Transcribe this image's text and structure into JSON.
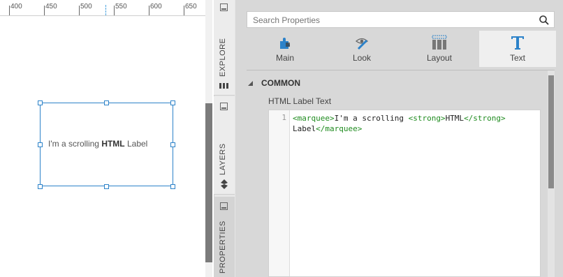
{
  "ruler": {
    "ticks": [
      "400",
      "450",
      "500",
      "550",
      "600",
      "650"
    ]
  },
  "canvas": {
    "label_widget": {
      "prefix": "I'm a scrolling ",
      "bold": "HTML",
      "suffix": " Label"
    }
  },
  "side_tabs": [
    {
      "label": "EXPLORE"
    },
    {
      "label": "LAYERS"
    },
    {
      "label": "PROPERTIES"
    }
  ],
  "properties_panel": {
    "search": {
      "placeholder": "Search Properties"
    },
    "categories": [
      {
        "label": "Main",
        "icon": "puzzle-icon"
      },
      {
        "label": "Look",
        "icon": "paint-brush-icon"
      },
      {
        "label": "Layout",
        "icon": "layout-grid-icon"
      },
      {
        "label": "Text",
        "icon": "text-t-icon",
        "selected": true
      }
    ],
    "section_title": "COMMON",
    "property_label": "HTML Label Text",
    "editor": {
      "line_number": "1",
      "line1_open": "<marquee>",
      "line1_text": "I'm a scrolling ",
      "line1_strong_open": "<strong>",
      "line1_strong_text": "HTML",
      "line1_strong_close": "</strong>",
      "line2_text": "Label",
      "line2_close": "</marquee>"
    },
    "colors": {
      "accent": "#2c82c9",
      "code_tag": "#1f8b1f"
    }
  }
}
